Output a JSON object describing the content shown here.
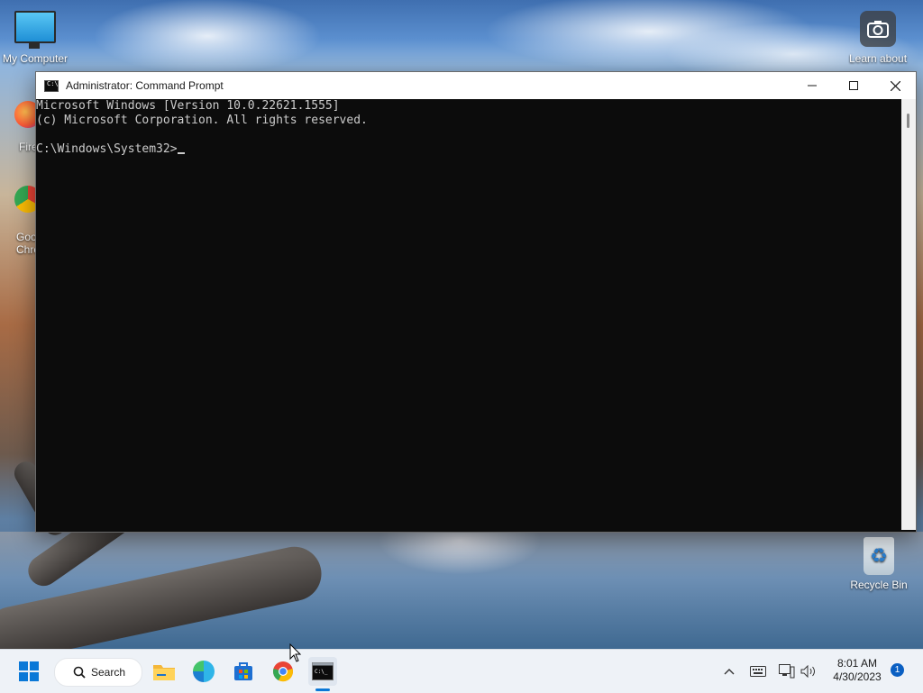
{
  "desktop": {
    "icons": [
      {
        "label": "My Computer"
      },
      {
        "label": "Learn about"
      },
      {
        "label": "Recycle Bin"
      },
      {
        "label": "Firef"
      },
      {
        "label": "Goo"
      },
      {
        "label": "Chro"
      }
    ]
  },
  "window": {
    "title": "Administrator: Command Prompt",
    "console_lines": [
      "Microsoft Windows [Version 10.0.22621.1555]",
      "(c) Microsoft Corporation. All rights reserved.",
      "",
      "C:\\Windows\\System32>"
    ]
  },
  "taskbar": {
    "search_label": "Search",
    "time": "8:01 AM",
    "date": "4/30/2023",
    "notification_count": "1"
  },
  "colors": {
    "accent": "#0a78d7",
    "console_bg": "#0c0c0c",
    "console_fg": "#cccccc"
  }
}
